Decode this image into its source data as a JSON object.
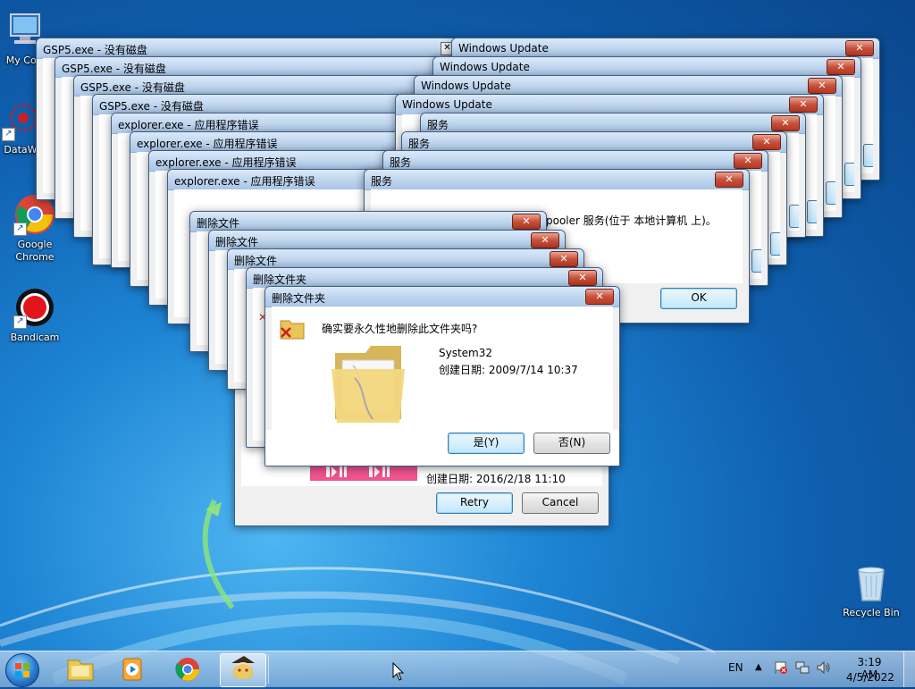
{
  "desktop": {
    "icons": [
      {
        "label": "My Cor",
        "name": "my-computer-icon"
      },
      {
        "label": "DataWa",
        "name": "datawa-icon"
      },
      {
        "label": "Google Chrome",
        "name": "google-chrome-icon"
      },
      {
        "label": "Bandicam",
        "name": "bandicam-icon"
      },
      {
        "label": "Recycle Bin",
        "name": "recycle-bin-icon"
      }
    ]
  },
  "windows": {
    "gsp": [
      {
        "title": "GSP5.exe - 没有磁盘"
      },
      {
        "title": "GSP5.exe - 没有磁盘"
      },
      {
        "title": "GSP5.exe - 没有磁盘"
      },
      {
        "title": "GSP5.exe - 没有磁盘"
      }
    ],
    "explorer": [
      {
        "title": "explorer.exe - 应用程序错误"
      },
      {
        "title": "explorer.exe - 应用程序错误"
      },
      {
        "title": "explorer.exe - 应用程序错误"
      },
      {
        "title": "explorer.exe - 应用程序错误"
      }
    ],
    "wu": [
      {
        "title": "Windows Update"
      },
      {
        "title": "Windows Update"
      },
      {
        "title": "Windows Update"
      },
      {
        "title": "Windows Update"
      }
    ],
    "svc": [
      {
        "title": "服务"
      },
      {
        "title": "服务"
      },
      {
        "title": "服务"
      },
      {
        "title": "服务",
        "message": "pooler 服务(位于 本地计算机 上)。",
        "ok": "OK"
      }
    ],
    "del": [
      {
        "title": "删除文件"
      },
      {
        "title": "删除文件"
      },
      {
        "title": "删除文件"
      },
      {
        "title": "删除文件夹"
      }
    ],
    "behind": {
      "created": "创建日期: 2016/2/18 11:10",
      "retry": "Retry",
      "cancel": "Cancel"
    },
    "front": {
      "title": "删除文件夹",
      "question": "确实要永久性地删除此文件夹吗?",
      "name": "System32",
      "created": "创建日期: 2009/7/14 10:37",
      "yes": "是(Y)",
      "no": "否(N)"
    }
  },
  "taskbar": {
    "lang": "EN",
    "time": "3:19 AM",
    "date": "4/5/2022",
    "items": [
      "windows-explorer-icon",
      "media-player-icon",
      "chrome-icon",
      "touhou-app-icon"
    ]
  },
  "colors": {
    "close": "#c7503b",
    "titlebar": "#bdd4ee",
    "wallpaper": "#1d84d4"
  }
}
